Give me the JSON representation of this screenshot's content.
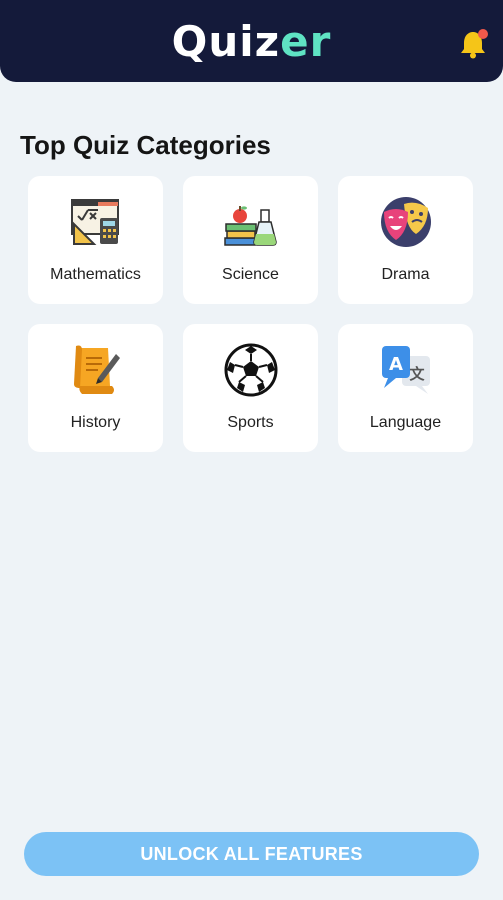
{
  "header": {
    "logo_part1": "Quiz",
    "logo_part2": "er",
    "bell_icon": "bell-icon",
    "colors": {
      "bg": "#141a3a",
      "logo": "#ffffff",
      "logo_accent": "#5fe3c3",
      "bell": "#f5c518",
      "badge": "#f2594b"
    }
  },
  "main": {
    "title": "Top Quiz Categories",
    "categories": [
      {
        "label": "Mathematics",
        "icon": "mathematics-icon"
      },
      {
        "label": "Science",
        "icon": "science-icon"
      },
      {
        "label": "Drama",
        "icon": "drama-masks-icon"
      },
      {
        "label": "History",
        "icon": "history-scroll-icon"
      },
      {
        "label": "Sports",
        "icon": "soccer-ball-icon"
      },
      {
        "label": "Language",
        "icon": "language-translate-icon"
      }
    ]
  },
  "footer": {
    "unlock_label": "UNLOCK ALL FEATURES",
    "colors": {
      "button_bg": "#7cc2f5",
      "button_text": "#ffffff"
    }
  }
}
